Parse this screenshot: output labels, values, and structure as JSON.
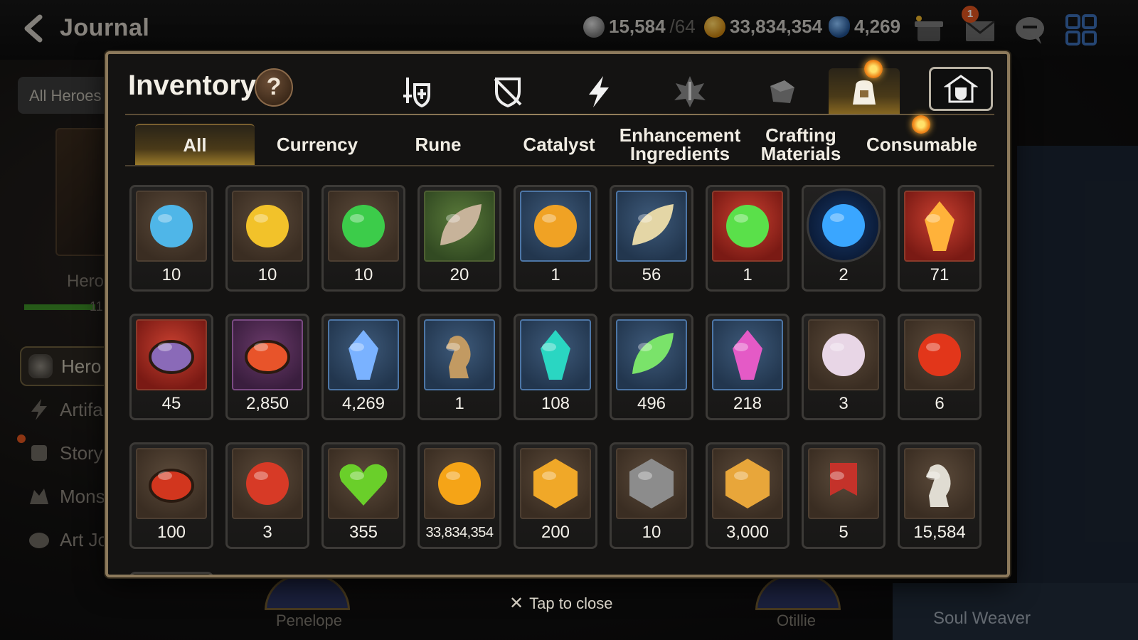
{
  "topbar": {
    "title": "Journal",
    "stamina": {
      "value": "15,584",
      "max": "/64"
    },
    "gold": "33,834,354",
    "skystone": "4,269",
    "mail_badge": "1"
  },
  "sidebar": {
    "all_heroes_tab": "All Heroes",
    "hero_label": "Hero",
    "hero_level": "11",
    "items": [
      {
        "label": "Hero",
        "icon": "hero-icon"
      },
      {
        "label": "Artifa",
        "icon": "lightning-icon"
      },
      {
        "label": "Story",
        "icon": "scroll-icon"
      },
      {
        "label": "Mons",
        "icon": "monster-icon"
      },
      {
        "label": "Art Jo",
        "icon": "palette-icon"
      }
    ]
  },
  "bottom": {
    "left_hero": "Penelope",
    "right_hero": "Otillie",
    "soul_weaver": "Soul Weaver"
  },
  "inventory": {
    "title": "Inventory",
    "help": "?",
    "categories": [
      {
        "name": "equipment",
        "icon": "sword-shield-icon"
      },
      {
        "name": "no-equipment",
        "icon": "crossed-shield-icon"
      },
      {
        "name": "artifact",
        "icon": "lightning-icon"
      },
      {
        "name": "material",
        "icon": "crest-icon"
      },
      {
        "name": "item-box",
        "icon": "dice-icon"
      },
      {
        "name": "consumable-bag",
        "icon": "bag-icon",
        "active": true
      },
      {
        "name": "storage",
        "icon": "house-shield-icon"
      }
    ],
    "tabs": [
      {
        "label": "All",
        "active": true
      },
      {
        "label": "Currency"
      },
      {
        "label": "Rune"
      },
      {
        "label": "Catalyst"
      },
      {
        "label": "Enhancement Ingredients"
      },
      {
        "label": "Crafting Materials"
      },
      {
        "label": "Consumable"
      }
    ],
    "items": [
      {
        "qty": "10",
        "frame": "brown",
        "icon": "blue-rune-icon",
        "color": "#4fb6e8"
      },
      {
        "qty": "10",
        "frame": "brown",
        "icon": "yellow-rune-icon",
        "color": "#f2c22a"
      },
      {
        "qty": "10",
        "frame": "brown",
        "icon": "green-rune-icon",
        "color": "#3ccc4a"
      },
      {
        "qty": "20",
        "frame": "green",
        "icon": "claw-icon",
        "color": "#c7b39a"
      },
      {
        "qty": "1",
        "frame": "blue",
        "icon": "sun-medallion-icon",
        "color": "#f0a224"
      },
      {
        "qty": "56",
        "frame": "blue",
        "icon": "root-herb-icon",
        "color": "#e4d6a6"
      },
      {
        "qty": "1",
        "frame": "red",
        "icon": "green-orb-icon",
        "color": "#5ae04a"
      },
      {
        "qty": "2",
        "frame": "round",
        "icon": "blue-circle-icon",
        "color": "#3aa6ff"
      },
      {
        "qty": "71",
        "frame": "red",
        "icon": "amber-crystal-icon",
        "color": "#ffb23a"
      },
      {
        "qty": "45",
        "frame": "red",
        "icon": "ring-pendant-icon",
        "color": "#8a6ab8"
      },
      {
        "qty": "2,850",
        "frame": "purple",
        "icon": "flower-ring-icon",
        "color": "#e8542a"
      },
      {
        "qty": "4,269",
        "frame": "blue",
        "icon": "skystone-icon",
        "color": "#7ab2ff"
      },
      {
        "qty": "1",
        "frame": "blue",
        "icon": "key-pendulum-icon",
        "color": "#c29a62"
      },
      {
        "qty": "108",
        "frame": "blue",
        "icon": "teal-crystal-icon",
        "color": "#2ad6c2"
      },
      {
        "qty": "496",
        "frame": "blue",
        "icon": "leaf-icon",
        "color": "#7ae36a"
      },
      {
        "qty": "218",
        "frame": "blue",
        "icon": "pink-crystal-icon",
        "color": "#e45ac6"
      },
      {
        "qty": "3",
        "frame": "brown",
        "icon": "robot-orb-icon",
        "color": "#e8d6e6"
      },
      {
        "qty": "6",
        "frame": "brown",
        "icon": "fire-orb-icon",
        "color": "#e2361a"
      },
      {
        "qty": "100",
        "frame": "brown",
        "icon": "red-bracelet-icon",
        "color": "#d2361e"
      },
      {
        "qty": "3",
        "frame": "brown",
        "icon": "red-seal-icon",
        "color": "#d73a26"
      },
      {
        "qty": "355",
        "frame": "brown",
        "icon": "heart-icon",
        "color": "#6acf2a"
      },
      {
        "qty": "33,834,354",
        "frame": "brown",
        "icon": "gold-coin-icon",
        "color": "#f5a417",
        "small": true
      },
      {
        "qty": "200",
        "frame": "brown",
        "icon": "gold-emblem-icon",
        "color": "#f0a828"
      },
      {
        "qty": "10",
        "frame": "brown",
        "icon": "compass-stone-icon",
        "color": "#8c8c8c"
      },
      {
        "qty": "3,000",
        "frame": "brown",
        "icon": "fist-badge-icon",
        "color": "#e8a63a"
      },
      {
        "qty": "5",
        "frame": "brown",
        "icon": "red-banner-icon",
        "color": "#c4322a"
      },
      {
        "qty": "15,584",
        "frame": "brown",
        "icon": "silver-horse-icon",
        "color": "#e0dcd2"
      }
    ]
  },
  "footer": {
    "close_text": "Tap to close"
  }
}
